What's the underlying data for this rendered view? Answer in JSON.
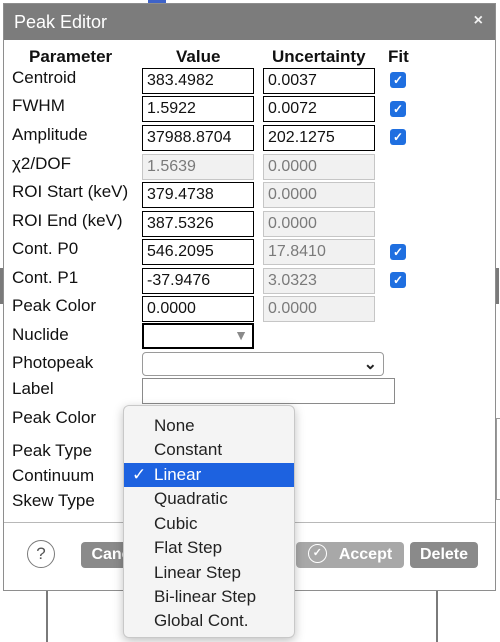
{
  "dialog": {
    "title": "Peak Editor"
  },
  "headers": {
    "parameter": "Parameter",
    "value": "Value",
    "uncertainty": "Uncertainty",
    "fit": "Fit"
  },
  "rows": [
    {
      "label": "Centroid",
      "value": "383.4982",
      "uncertainty": "0.0037"
    },
    {
      "label": "FWHM",
      "value": "1.5922",
      "uncertainty": "0.0072"
    },
    {
      "label": "Amplitude",
      "value": "37988.8704",
      "uncertainty": "202.1275"
    },
    {
      "label": "χ2/DOF",
      "value": "1.5639",
      "uncertainty": "0.0000"
    },
    {
      "label": "ROI Start (keV)",
      "value": "379.4738",
      "uncertainty": "0.0000"
    },
    {
      "label": "ROI End (keV)",
      "value": "387.5326",
      "uncertainty": "0.0000"
    },
    {
      "label": "Cont. P0",
      "value": "546.2095",
      "uncertainty": "17.8410"
    },
    {
      "label": "Cont. P1",
      "value": "-37.9476",
      "uncertainty": "3.0323"
    },
    {
      "label": "Peak Color",
      "value": "0.0000",
      "uncertainty": "0.0000"
    }
  ],
  "labels": {
    "nuclide": "Nuclide",
    "photopeak": "Photopeak",
    "label": "Label",
    "peak_color": "Peak Color",
    "peak_type": "Peak Type",
    "continuum": "Continuum",
    "skew_type": "Skew Type"
  },
  "fit_checks": {
    "centroid": "✓",
    "fwhm": "✓",
    "amplitude": "✓",
    "cont_p0": "✓",
    "cont_p1": "✓"
  },
  "continuum_options": [
    "None",
    "Constant",
    "Linear",
    "Quadratic",
    "Cubic",
    "Flat Step",
    "Linear Step",
    "Bi-linear Step",
    "Global Cont."
  ],
  "continuum_selected": "Linear",
  "icons": {
    "close": "×",
    "help": "?",
    "check": "✓",
    "dropdown": "▼",
    "chevron": "⌄"
  },
  "buttons": {
    "cancel": "Canc",
    "accept": "Accept",
    "delete": "Delete"
  },
  "colors": {
    "titlebar": "#7c7c7c",
    "accent": "#1d62e0",
    "button": "#8a8a8a"
  }
}
